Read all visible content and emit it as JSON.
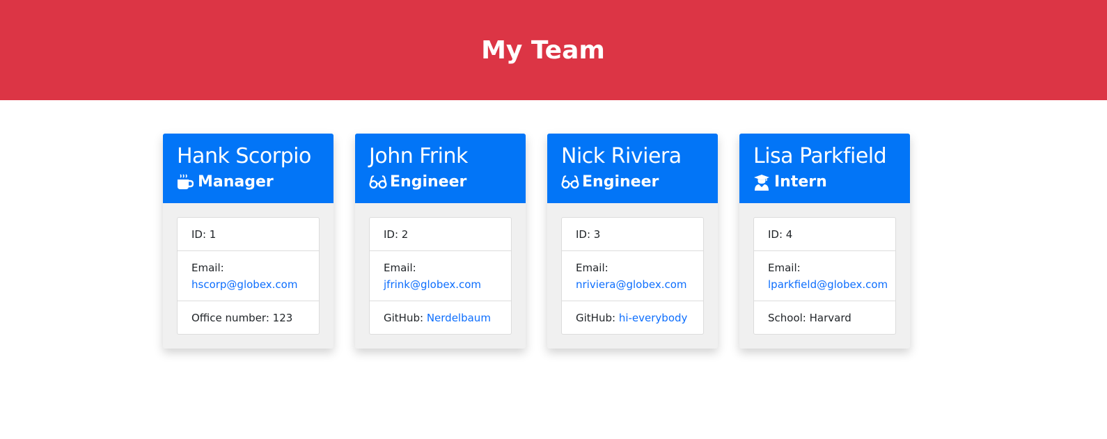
{
  "header": {
    "title": "My Team"
  },
  "team": [
    {
      "name": "Hank Scorpio",
      "role": "Manager",
      "icon": "coffee-icon",
      "id_label": "ID: 1",
      "email_label": "Email:",
      "email": "hscorp@globex.com",
      "extra_label": "Office number: 123",
      "extra_value": ""
    },
    {
      "name": "John Frink",
      "role": "Engineer",
      "icon": "glasses-icon",
      "id_label": "ID: 2",
      "email_label": "Email:",
      "email": "jfrink@globex.com",
      "extra_label": "GitHub:",
      "extra_value": "Nerdelbaum"
    },
    {
      "name": "Nick Riviera",
      "role": "Engineer",
      "icon": "glasses-icon",
      "id_label": "ID: 3",
      "email_label": "Email:",
      "email": "nriviera@globex.com",
      "extra_label": "GitHub:",
      "extra_value": "hi-everybody"
    },
    {
      "name": "Lisa Parkfield",
      "role": "Intern",
      "icon": "graduate-icon",
      "id_label": "ID: 4",
      "email_label": "Email:",
      "email": "lparkfield@globex.com",
      "extra_label": "School: Harvard",
      "extra_value": ""
    }
  ],
  "colors": {
    "header_bg": "#dc3545",
    "card_head_bg": "#0275f7",
    "link": "#0d6efd"
  }
}
